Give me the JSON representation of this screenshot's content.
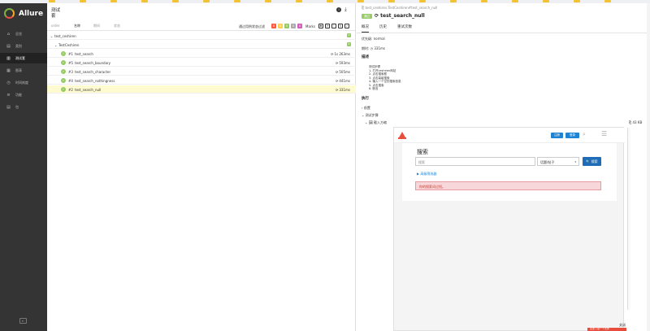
{
  "browser": {
    "bookmarks": [
      "",
      "",
      "",
      "",
      "",
      "",
      "",
      "",
      "",
      "",
      "",
      "",
      "",
      "",
      "",
      "",
      "",
      "",
      ""
    ],
    "bookmark_labels": [
      "",
      "",
      "",
      ""
    ]
  },
  "sidebar": {
    "logo_text": "Allure",
    "items": [
      {
        "icon": "home-icon",
        "glyph": "⌂",
        "label": "总览"
      },
      {
        "icon": "categories-icon",
        "glyph": "▤",
        "label": "类别"
      },
      {
        "icon": "suites-icon",
        "glyph": "▥",
        "label": "测试套"
      },
      {
        "icon": "graphs-icon",
        "glyph": "▦",
        "label": "图表"
      },
      {
        "icon": "timeline-icon",
        "glyph": "◷",
        "label": "时间刻度"
      },
      {
        "icon": "behaviors-icon",
        "glyph": "≡",
        "label": "功能"
      },
      {
        "icon": "packages-icon",
        "glyph": "▤",
        "label": "包"
      }
    ],
    "active_index": 2,
    "collapse_label": "⇤"
  },
  "suites": {
    "title": "测试",
    "subtitle": "套",
    "sort": [
      "order",
      "名称",
      "期间",
      "状态"
    ],
    "sort_active": 1,
    "filter_label": "通过用例状态过滤",
    "status_counts": [
      {
        "name": "failed",
        "value": "0",
        "color": "#fd5a3e"
      },
      {
        "name": "broken",
        "value": "0",
        "color": "#ffd050"
      },
      {
        "name": "passed",
        "value": "5",
        "color": "#97cc64"
      },
      {
        "name": "skipped",
        "value": "0",
        "color": "#aaaaaa"
      },
      {
        "name": "unknown",
        "value": "0",
        "color": "#d35ebe"
      }
    ],
    "marks_label": "Marks",
    "marks": [
      "✱",
      "⟳",
      "!",
      "↻",
      "✓"
    ],
    "tree": {
      "root": {
        "caret": "⌄",
        "name": "test_ceshiren",
        "count": "5"
      },
      "group": {
        "caret": "⌄",
        "name": "TestCeshiren",
        "count": "5"
      },
      "tests": [
        {
          "num": "#1",
          "name": "test_search",
          "duration": "1s 263ms",
          "selected": false
        },
        {
          "num": "#5",
          "name": "test_search_boundary",
          "duration": "593ms",
          "selected": false
        },
        {
          "num": "#3",
          "name": "test_search_character",
          "duration": "505ms",
          "selected": false
        },
        {
          "num": "#4",
          "name": "test_search_nothingness",
          "duration": "441ms",
          "selected": false
        },
        {
          "num": "#2",
          "name": "test_search_null",
          "duration": "331ms",
          "selected": true
        }
      ]
    }
  },
  "detail": {
    "breadcrumb": "⎘ test_ceshiren.TestCeshiren#test_search_null",
    "status": "通过",
    "title": "test_search_null",
    "tabs": [
      "概况",
      "历史",
      "重试次数"
    ],
    "active_tab": 0,
    "severity_label": "优先级: normal",
    "duration_label": "期时: ◷ 331ms",
    "description_title": "描述",
    "description_lines": [
      "测试步骤",
      "1. 打开ceshiren网站",
      "2. 点击搜索框",
      "3. 点击高级搜索",
      "4. 输入一个空的搜索信息",
      "5. 点击搜索",
      "6. 断言"
    ],
    "execution_title": "执行",
    "setup_title": "› 前置",
    "body_title": "⌄ 测试步骤",
    "step_label": "⌄ 🖼 截入方缩",
    "step_time": "⎘ 43 KB"
  },
  "screenshot": {
    "register": "注册",
    "login": "登录",
    "heading": "搜索",
    "search_placeholder": "搜索",
    "select_value": "话题/帖子",
    "caret": "▾",
    "search_button": "🔍 搜索",
    "advanced": "▶ 高级筛选器",
    "alert": "你的搜索词过短。",
    "search_icon": "⌕",
    "menu_icon": "☰"
  },
  "footer": {
    "close_label": "关闭",
    "red_strip_text": "点击下载一个文件"
  }
}
